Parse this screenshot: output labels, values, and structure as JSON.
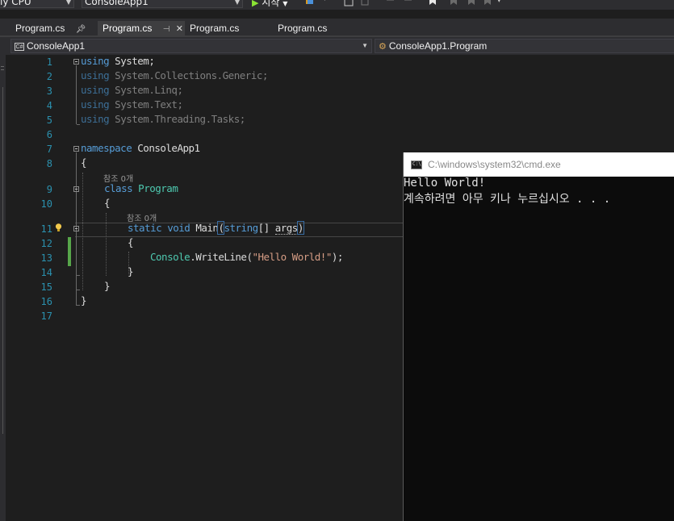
{
  "toolbar": {
    "platform": "ly CPU",
    "project": "ConsoleApp1",
    "start_label": "시작"
  },
  "tabs": [
    {
      "label": "Program.cs",
      "pinned": true
    },
    {
      "label": "Program.cs",
      "active": true,
      "pin_glyph": "⊣"
    },
    {
      "label": "Program.cs"
    },
    {
      "label": "Program.cs"
    }
  ],
  "navbar": {
    "project_label": "ConsoleApp1",
    "project_icon": "C#",
    "member_label": "ConsoleApp1.Program"
  },
  "editor": {
    "line_numbers": [
      "1",
      "2",
      "3",
      "4",
      "5",
      "6",
      "7",
      "8",
      "9",
      "10",
      "11",
      "12",
      "13",
      "14",
      "15",
      "16",
      "17"
    ],
    "using_keyword": "using",
    "usings": [
      "System;",
      "System.Collections.Generic;",
      "System.Linq;",
      "System.Text;",
      "System.Threading.Tasks;"
    ],
    "namespace_keyword": "namespace",
    "namespace_name": "ConsoleApp1",
    "class_keyword": "class",
    "class_name": "Program",
    "static_keyword": "static",
    "void_keyword": "void",
    "method_name": "Main",
    "param_type": "string",
    "param_name": "args",
    "console_type": "Console",
    "writeline_call": ".WriteLine(",
    "string_literal": "\"Hello World!\"",
    "call_end": ");",
    "open_brace": "{",
    "close_brace": "}",
    "open_paren": "(",
    "brackets": "[] ",
    "close_paren": ")",
    "lens_class": "참조 0개",
    "lens_method": "참조 0개"
  },
  "console": {
    "title": "C:\\windows\\system32\\cmd.exe",
    "icon_text": "C:\\",
    "lines": [
      "Hello World!",
      "계속하려면 아무 키나 누르십시오 . . ."
    ]
  },
  "colors": {
    "background": "#1e1e1e",
    "keyword": "#569cd6",
    "type": "#4ec9b0",
    "string": "#d69d85",
    "line_number": "#2b91af",
    "change_bar": "#57a64a"
  }
}
